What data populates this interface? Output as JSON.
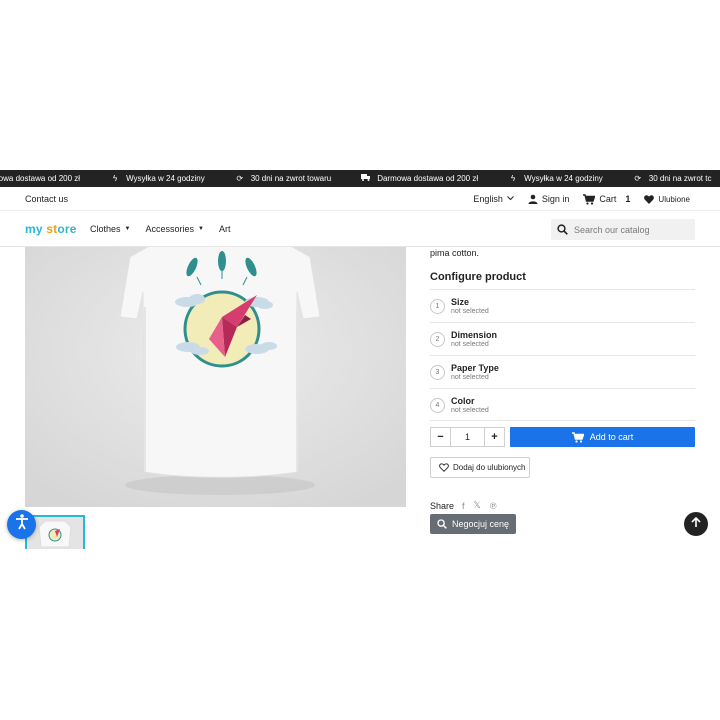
{
  "promo_bar": {
    "items": [
      {
        "icon": "truck-icon",
        "text": "mowa dostawa od 200 zł"
      },
      {
        "icon": "lightning-icon",
        "text": "Wysyłka w 24 godziny"
      },
      {
        "icon": "refresh-icon",
        "text": "30 dni na zwrot towaru"
      },
      {
        "icon": "truck-icon",
        "text": "Darmowa dostawa od 200 zł"
      },
      {
        "icon": "lightning-icon",
        "text": "Wysyłka w 24 godziny"
      },
      {
        "icon": "refresh-icon",
        "text": "30 dni na zwrot tc"
      }
    ]
  },
  "nav_top": {
    "contact": "Contact us",
    "language": "English",
    "signin": "Sign in",
    "cart_label": "Cart",
    "cart_count": "1",
    "favorites": "Ulubione"
  },
  "header": {
    "logo_part1": "my",
    "logo_part2": " st",
    "logo_part3": "ore",
    "menu": [
      "Clothes",
      "Accessories",
      "Art"
    ],
    "search_placeholder": "Search our catalog"
  },
  "product": {
    "description_tail": "pima cotton.",
    "configure_title": "Configure product",
    "options": [
      {
        "num": "1",
        "name": "Size",
        "status": "not selected"
      },
      {
        "num": "2",
        "name": "Dimension",
        "status": "not selected"
      },
      {
        "num": "3",
        "name": "Paper Type",
        "status": "not selected"
      },
      {
        "num": "4",
        "name": "Color",
        "status": "not selected"
      }
    ],
    "quantity": "1",
    "qty_minus": "−",
    "qty_plus": "+",
    "add_to_cart": "Add to cart",
    "wishlist": "Dodaj do ulubionych",
    "share_label": "Share",
    "share_icons": [
      "facebook-icon",
      "x-icon",
      "pinterest-icon"
    ],
    "negotiate": "Negocjuj cenę"
  },
  "colors": {
    "primary": "#1a73e8",
    "dark": "#232323",
    "secondary_button": "#666d75",
    "logo_blue": "#24b9d7",
    "logo_orange": "#f39d12"
  }
}
